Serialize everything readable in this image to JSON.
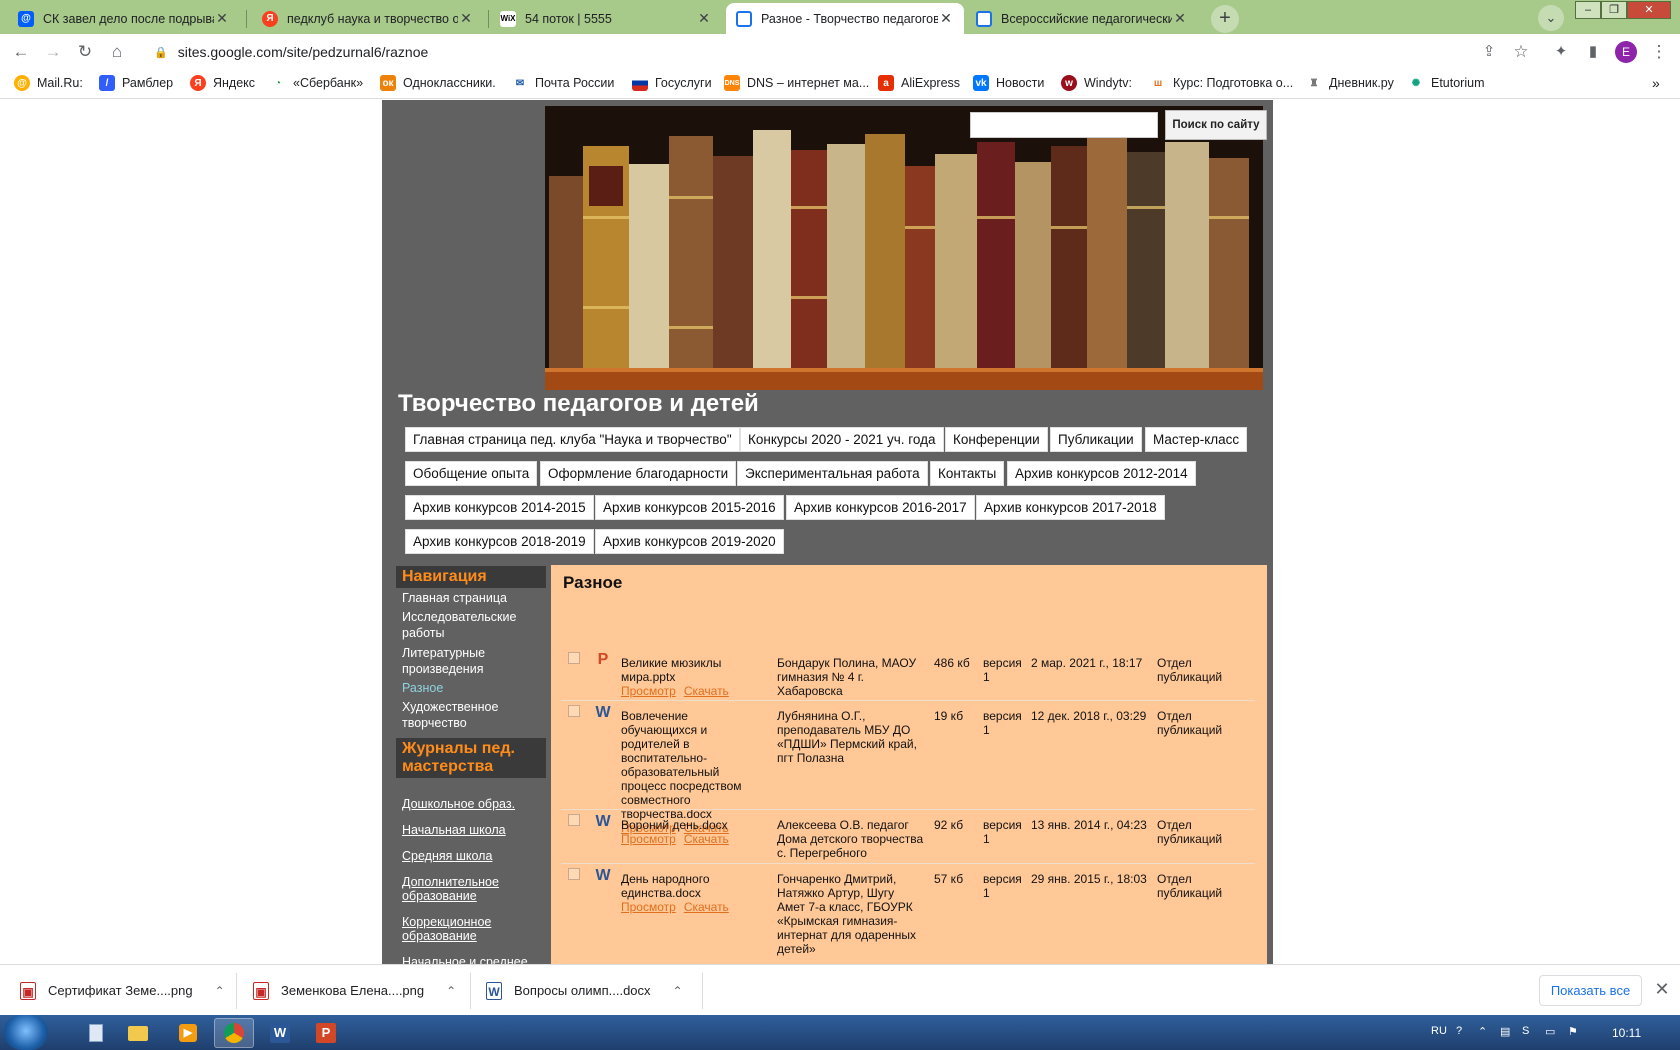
{
  "browser": {
    "tabs": [
      {
        "title": "СК завел дело после подрыва м",
        "favicon": "mail-ru-icon",
        "favicon_color": "#005ff9"
      },
      {
        "title": "педклуб наука и творчество оф",
        "favicon": "yandex-icon",
        "favicon_color": "#fc3f1d"
      },
      {
        "title": "54 поток | 5555",
        "favicon": "wix-icon",
        "favicon_color": "#000000"
      },
      {
        "title": "Разное - Творчество педагогов",
        "favicon": "google-sites-icon",
        "favicon_color": "#1a73e8",
        "active": true
      },
      {
        "title": "Всероссийские педагогические",
        "favicon": "google-sites-icon",
        "favicon_color": "#1a73e8"
      }
    ],
    "url": "sites.google.com/site/pedzurnal6/raznoe",
    "profile_initial": "E",
    "bookmarks": [
      {
        "label": "Mail.Ru:",
        "icon": "mail-ru-icon"
      },
      {
        "label": "Рамблер",
        "icon": "rambler-icon"
      },
      {
        "label": "Яндекс",
        "icon": "yandex-icon"
      },
      {
        "label": "«Сбербанк»",
        "icon": "sberbank-icon"
      },
      {
        "label": "Одноклассники.",
        "icon": "odnoklassniki-icon"
      },
      {
        "label": "Почта России",
        "icon": "pochta-icon"
      },
      {
        "label": "Госуслуги",
        "icon": "gosuslugi-icon"
      },
      {
        "label": "DNS – интернет ма...",
        "icon": "dns-icon"
      },
      {
        "label": "AliExpress",
        "icon": "aliexpress-icon"
      },
      {
        "label": "Новости",
        "icon": "vk-icon"
      },
      {
        "label": "Windytv:",
        "icon": "windy-icon"
      },
      {
        "label": "Курс: Подготовка о...",
        "icon": "course-icon"
      },
      {
        "label": "Дневник.ру",
        "icon": "dnevnik-icon"
      },
      {
        "label": "Etutorium",
        "icon": "etutorium-icon"
      }
    ],
    "bookmarks_overflow": "»"
  },
  "site": {
    "search_button": "Поиск по сайту",
    "title": "Творчество педагогов и детей",
    "top_nav": [
      "Главная страница пед. клуба \"Наука и творчество\"",
      "Конкурсы 2020 - 2021 уч. года",
      "Конференции",
      "Публикации",
      "Мастер-класс",
      "Обобщение опыта",
      "Оформление благодарности",
      "Экспериментальная работа",
      "Контакты",
      "Архив конкурсов 2012-2014",
      "Архив конкурсов 2014-2015",
      "Архив конкурсов 2015-2016",
      "Архив конкурсов 2016-2017",
      "Архив конкурсов 2017-2018",
      "Архив конкурсов 2018-2019",
      "Архив конкурсов 2019-2020"
    ],
    "sidebar": {
      "nav_heading": "Навигация",
      "nav_items": [
        {
          "label": "Главная страница"
        },
        {
          "label": "Исследовательские работы"
        },
        {
          "label": "Литературные произведения"
        },
        {
          "label": "Разное",
          "current": true
        },
        {
          "label": "Художественное творчество"
        }
      ],
      "journals_heading": "Журналы пед. мастерства",
      "journals": [
        "Дошкольное образ.",
        "Начальная школа",
        "Средняя школа",
        "Дополнительное образование",
        "Коррекционное образование",
        "Начальное и среднее"
      ]
    },
    "content": {
      "title": "Разное",
      "view_label": "Просмотр",
      "download_label": "Скачать",
      "files": [
        {
          "type": "P",
          "type_color": "#d24726",
          "name": "Великие мюзиклы мира.pptx",
          "author": "Бондарук Полина, МАОУ гимназия № 4 г. Хабаровска",
          "size": "486 кб",
          "version": "версия 1",
          "date": "2 мар. 2021 г., 18:17",
          "section": "Отдел публикаций"
        },
        {
          "type": "W",
          "type_color": "#2b5797",
          "name": "Вовлечение обучающихся и родителей в воспитательно-образовательный процесс посредством совместного творчества.docx",
          "author": "Лубнянина О.Г., преподаватель МБУ ДО «ПДШИ» Пермский край, пгт Полазна",
          "size": "19 кб",
          "version": "версия 1",
          "date": "12 дек. 2018 г., 03:29",
          "section": "Отдел публикаций"
        },
        {
          "type": "W",
          "type_color": "#2b5797",
          "name": "Вороний день.docx",
          "author": "Алексеева О.В. педагог Дома детского творчества с. Перегребного",
          "size": "92 кб",
          "version": "версия 1",
          "date": "13 янв. 2014 г., 04:23",
          "section": "Отдел публикаций"
        },
        {
          "type": "W",
          "type_color": "#2b5797",
          "name": "День народного единства.docx",
          "author": "Гончаренко Дмитрий, Натяжко Артур, Шугу Амет 7-а класс, ГБОУРК «Крымская гимназия-интернат для одаренных детей»",
          "size": "57 кб",
          "version": "версия 1",
          "date": "29 янв. 2015 г., 18:03",
          "section": "Отдел публикаций"
        }
      ]
    }
  },
  "downloads": {
    "items": [
      {
        "name": "Сертификат Земе....png",
        "icon": "image-file-icon"
      },
      {
        "name": "Земенкова Елена....png",
        "icon": "image-file-icon"
      },
      {
        "name": "Вопросы олимп....docx",
        "icon": "word-file-icon"
      }
    ],
    "show_all": "Показать все"
  },
  "taskbar": {
    "lang": "RU",
    "time": "10:11",
    "apps": [
      "explorer-icon",
      "folder-icon",
      "media-player-icon",
      "chrome-icon",
      "word-icon",
      "powerpoint-icon"
    ]
  }
}
